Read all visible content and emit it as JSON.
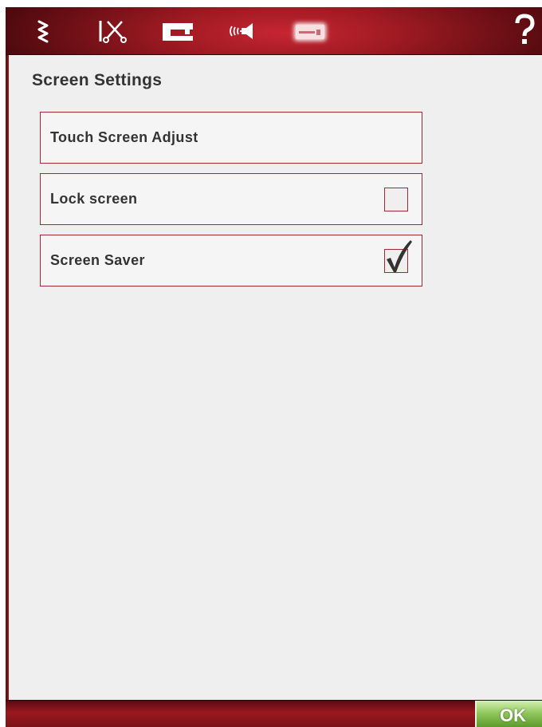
{
  "toolbar": {
    "icons": [
      {
        "name": "stitch-icon",
        "active": false
      },
      {
        "name": "scissors-icon",
        "active": false
      },
      {
        "name": "sewing-machine-icon",
        "active": false
      },
      {
        "name": "sound-icon",
        "active": false
      },
      {
        "name": "screen-settings-icon",
        "active": true
      }
    ],
    "help_label": "?"
  },
  "page": {
    "title": "Screen Settings"
  },
  "settings": [
    {
      "label": "Touch Screen Adjust",
      "has_checkbox": false
    },
    {
      "label": "Lock screen",
      "has_checkbox": true,
      "checked": false
    },
    {
      "label": "Screen Saver",
      "has_checkbox": true,
      "checked": true
    }
  ],
  "footer": {
    "ok_label": "OK"
  },
  "colors": {
    "accent": "#a5262e",
    "topbar": "#a01a22",
    "ok_button": "#7ab547",
    "background": "#efefef"
  }
}
